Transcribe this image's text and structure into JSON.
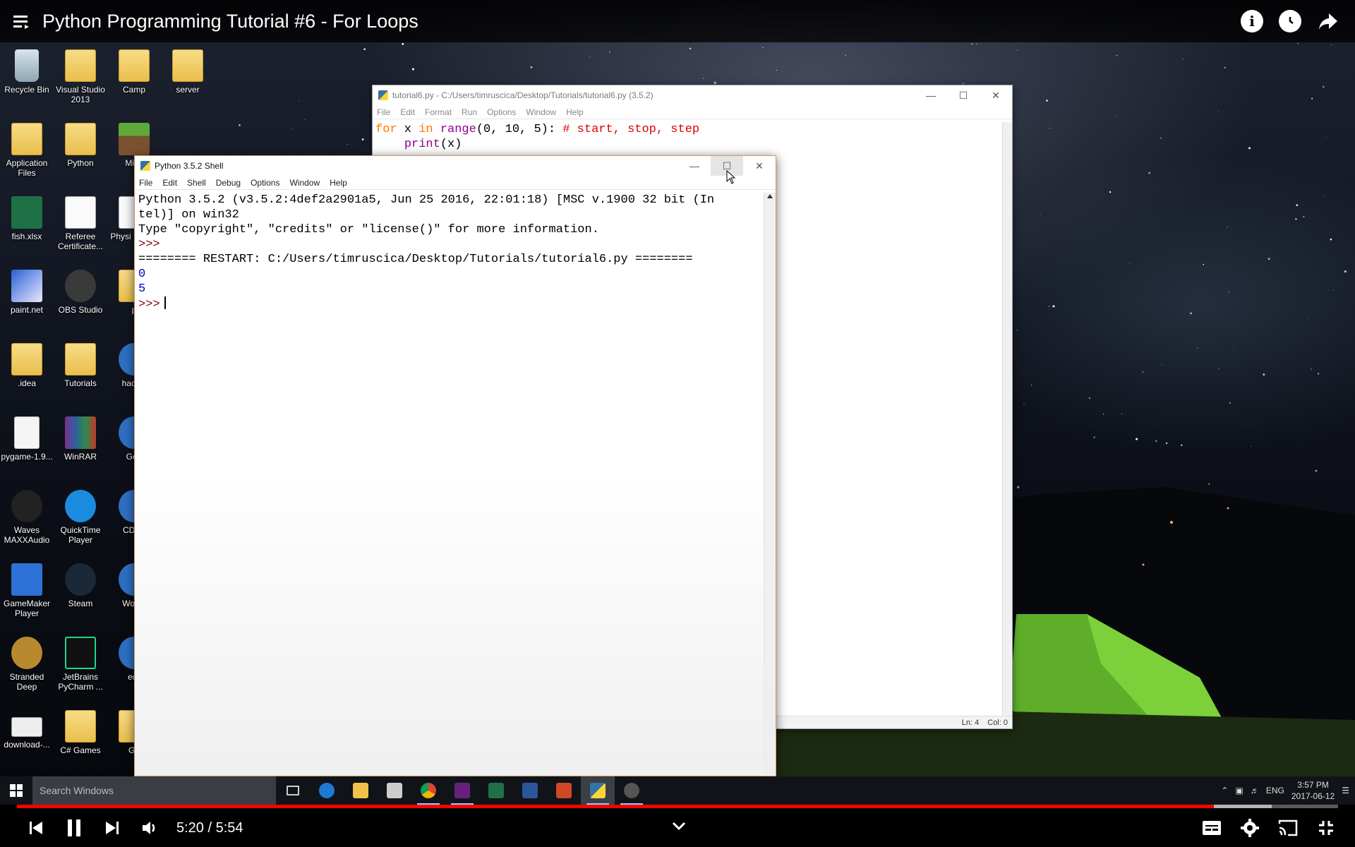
{
  "video": {
    "title": "Python Programming Tutorial #6 - For Loops",
    "time_current": "5:20",
    "time_sep": " / ",
    "time_total": "5:54",
    "progress_fraction": 0.906,
    "buffered_fraction": 0.95,
    "colors": {
      "played": "#ff0000"
    }
  },
  "desktop_icons": [
    {
      "label": "Recycle Bin",
      "icon": "recycle-bin-icon"
    },
    {
      "label": "Visual Studio 2013",
      "icon": "folder-icon"
    },
    {
      "label": "Camp",
      "icon": "folder-icon"
    },
    {
      "label": "server",
      "icon": "folder-icon"
    },
    {
      "label": "Application Files",
      "icon": "folder-icon"
    },
    {
      "label": "Python",
      "icon": "folder-icon"
    },
    {
      "label": "Minc",
      "icon": "minecraft-icon"
    },
    {
      "label": "fish.xlsx",
      "icon": "excel-file-icon"
    },
    {
      "label": "Referee Certificate...",
      "icon": "document-icon"
    },
    {
      "label": "Physi Resea",
      "icon": "word-file-icon"
    },
    {
      "label": "paint.net",
      "icon": "paint-net-icon"
    },
    {
      "label": "OBS Studio",
      "icon": "obs-icon"
    },
    {
      "label": "p",
      "icon": "folder-icon"
    },
    {
      "label": ".idea",
      "icon": "folder-icon"
    },
    {
      "label": "Tutorials",
      "icon": "folder-icon"
    },
    {
      "label": "hackin",
      "icon": "app-icon"
    },
    {
      "label": "pygame-1.9...",
      "icon": "file-icon"
    },
    {
      "label": "WinRAR",
      "icon": "winrar-icon"
    },
    {
      "label": "God",
      "icon": "app-icon"
    },
    {
      "label": "Waves MAXXAudio",
      "icon": "waves-icon"
    },
    {
      "label": "QuickTime Player",
      "icon": "quicktime-icon"
    },
    {
      "label": "CDBu",
      "icon": "cd-icon"
    },
    {
      "label": "GameMaker Player",
      "icon": "gamemaker-icon"
    },
    {
      "label": "Steam",
      "icon": "steam-icon"
    },
    {
      "label": "Wo Ta",
      "icon": "app-icon"
    },
    {
      "label": "Stranded Deep",
      "icon": "stranded-deep-icon"
    },
    {
      "label": "JetBrains PyCharm ...",
      "icon": "pycharm-icon"
    },
    {
      "label": "ecli",
      "icon": "eclipse-icon"
    },
    {
      "label": "download-...",
      "icon": "python-installer-icon"
    },
    {
      "label": "C# Games",
      "icon": "folder-icon"
    },
    {
      "label": "Ga",
      "icon": "folder-icon"
    }
  ],
  "editor": {
    "title": "tutorial6.py - C:/Users/timruscica/Desktop/Tutorials/tutorial6.py (3.5.2)",
    "menu": [
      "File",
      "Edit",
      "Format",
      "Run",
      "Options",
      "Window",
      "Help"
    ],
    "line1": {
      "kw_for": "for",
      "var": " x ",
      "kw_in": "in",
      "sp": " ",
      "builtin": "range",
      "args": "(0, 10, 5): ",
      "comment": "# start, stop, step"
    },
    "line2": {
      "indent": "    ",
      "builtin": "print",
      "args": "(x)"
    },
    "status_ln": "Ln: 4",
    "status_col": "Col: 0"
  },
  "shell": {
    "title": "Python 3.5.2 Shell",
    "menu": [
      "File",
      "Edit",
      "Shell",
      "Debug",
      "Options",
      "Window",
      "Help"
    ],
    "banner1": "Python 3.5.2 (v3.5.2:4def2a2901a5, Jun 25 2016, 22:01:18) [MSC v.1900 32 bit (In",
    "banner2": "tel)] on win32",
    "banner3": "Type \"copyright\", \"credits\" or \"license()\" for more information.",
    "prompt": ">>>",
    "restart": "======== RESTART: C:/Users/timruscica/Desktop/Tutorials/tutorial6.py ========",
    "out1": "0",
    "out2": "5",
    "prompt2": ">>>"
  },
  "taskbar": {
    "search_placeholder": "Search Windows",
    "apps": [
      "task-view-icon",
      "edge-icon",
      "file-explorer-icon",
      "store-icon",
      "chrome-icon",
      "visual-studio-icon",
      "excel-icon",
      "word-icon",
      "powerpoint-icon",
      "python-idle-icon",
      "obs-icon"
    ],
    "lang": "ENG",
    "time": "3:57 PM",
    "date": "2017-06-12"
  }
}
